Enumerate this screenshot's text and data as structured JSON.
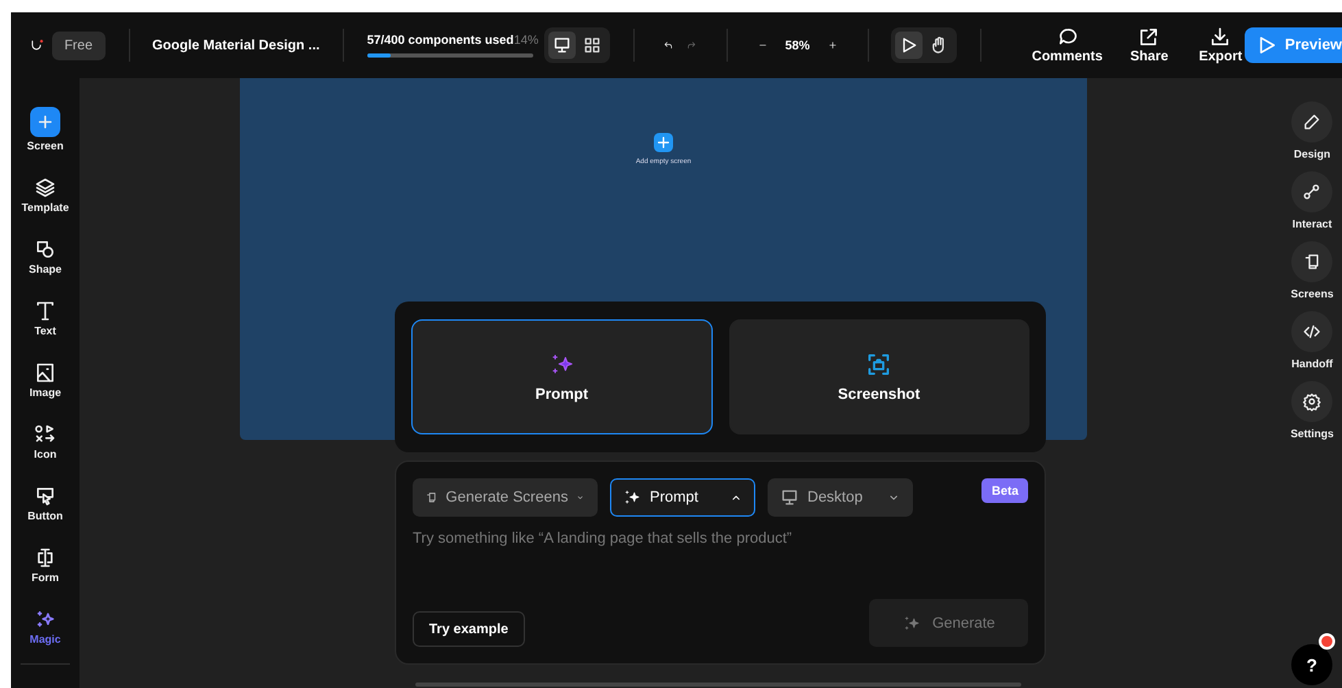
{
  "topbar": {
    "plan": "Free",
    "project": "Google Material Design ...",
    "usage": {
      "label": "57/400 components used",
      "percent": "14%",
      "level": 0.14
    },
    "views": [
      {
        "kind": "desktop",
        "selected": true
      },
      {
        "kind": "components",
        "selected": false
      }
    ],
    "zoom": "58%",
    "tools": [
      {
        "kind": "pointer",
        "selected": true
      },
      {
        "kind": "hand",
        "selected": false
      }
    ],
    "actions": [
      {
        "kind": "comment",
        "label": "Comments"
      },
      {
        "kind": "share",
        "label": "Share"
      },
      {
        "kind": "export",
        "label": "Export"
      }
    ],
    "preview": "Preview"
  },
  "left_toolbar": [
    {
      "kind": "screen",
      "label": "Screen",
      "selected": false
    },
    {
      "kind": "template",
      "label": "Template",
      "selected": false
    },
    {
      "kind": "shape",
      "label": "Shape",
      "selected": false
    },
    {
      "kind": "text",
      "label": "Text",
      "selected": false
    },
    {
      "kind": "image",
      "label": "Image",
      "selected": false
    },
    {
      "kind": "icon",
      "label": "Icon",
      "selected": false
    },
    {
      "kind": "button",
      "label": "Button",
      "selected": false
    },
    {
      "kind": "form",
      "label": "Form",
      "selected": false
    },
    {
      "kind": "magic",
      "label": "Magic",
      "selected": true
    }
  ],
  "canvas": {
    "add_screen": "Add empty screen"
  },
  "right_panel": [
    {
      "kind": "design",
      "label": "Design"
    },
    {
      "kind": "interact",
      "label": "Interact"
    },
    {
      "kind": "screens",
      "label": "Screens"
    },
    {
      "kind": "handoff",
      "label": "Handoff"
    },
    {
      "kind": "settings",
      "label": "Settings"
    }
  ],
  "ai_panel": {
    "modes": [
      {
        "kind": "prompt",
        "label": "Prompt",
        "selected": true
      },
      {
        "kind": "screenshot",
        "label": "Screenshot",
        "selected": false
      }
    ],
    "dropdowns": [
      {
        "kind": "screens",
        "label": "Generate Screens",
        "expanded": false,
        "selected": false
      },
      {
        "kind": "magic",
        "label": "Prompt",
        "expanded": true,
        "selected": true
      },
      {
        "kind": "desktop",
        "label": "Desktop",
        "expanded": false,
        "selected": false
      }
    ],
    "badge": "Beta",
    "placeholder": "Try something like “A landing page that sells the product”",
    "try_example": "Try example",
    "generate": {
      "label": "Generate",
      "disabled": true
    }
  },
  "help": {
    "label": "?",
    "notification": true
  }
}
